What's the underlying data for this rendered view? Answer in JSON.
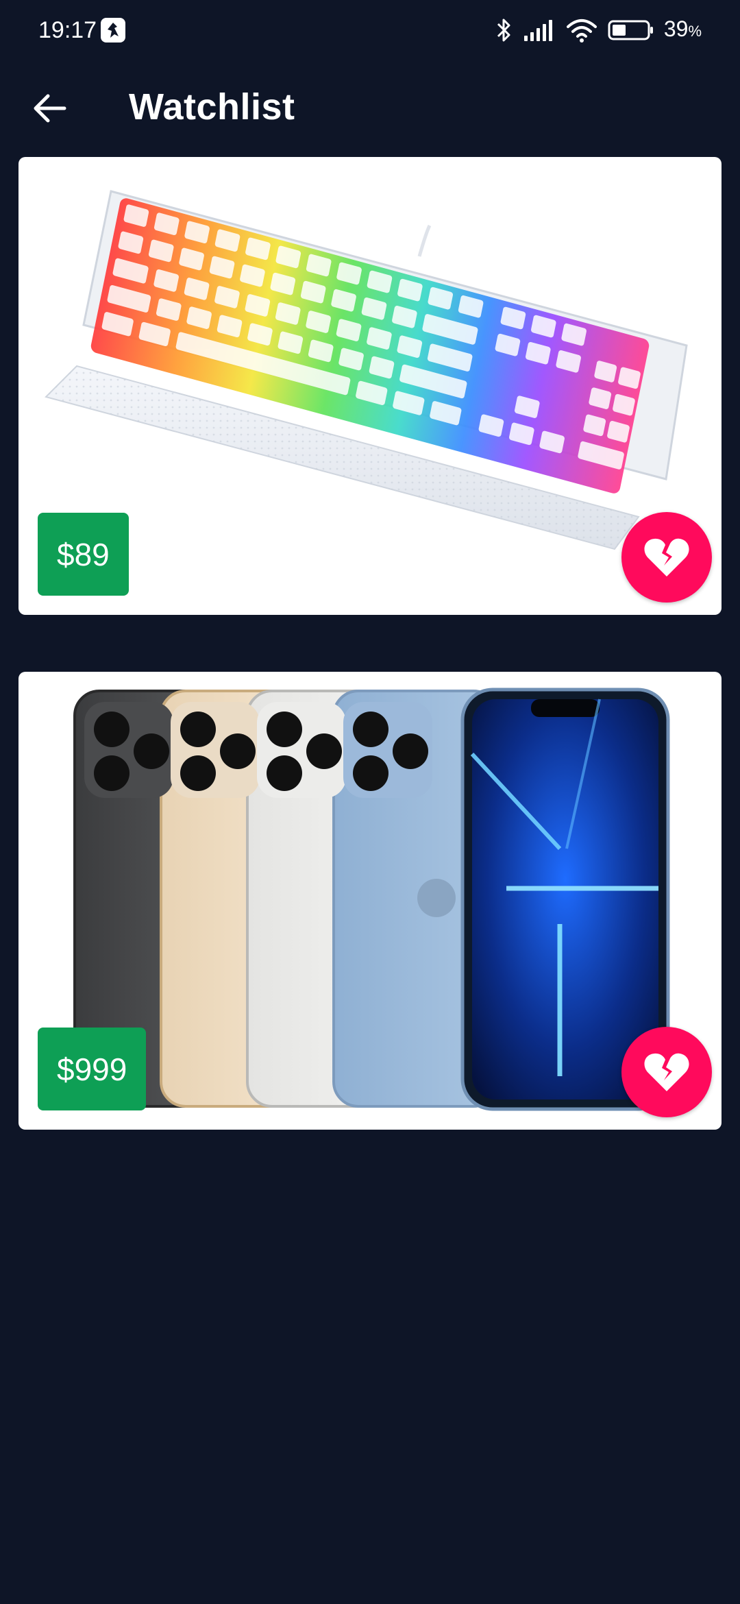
{
  "status_bar": {
    "time": "19:17",
    "battery_percent": "39",
    "battery_suffix": "%",
    "battery_level": 0.39,
    "icons": [
      "app-notification-icon",
      "bluetooth-icon",
      "signal-icon",
      "wifi-icon",
      "battery-icon"
    ]
  },
  "app_bar": {
    "title": "Watchlist",
    "back_icon": "arrow-left-icon"
  },
  "watchlist": [
    {
      "product": "keyboard",
      "price": "$89",
      "image_icon": "rgb-keyboard-image",
      "action_icon": "broken-heart-icon"
    },
    {
      "product": "phones",
      "price": "$999",
      "image_icon": "smartphones-image",
      "action_icon": "broken-heart-icon"
    }
  ],
  "colors": {
    "background": "#0e1527",
    "card": "#ffffff",
    "price_badge": "#0e9f55",
    "unwatch_button": "#ff0a5c"
  }
}
